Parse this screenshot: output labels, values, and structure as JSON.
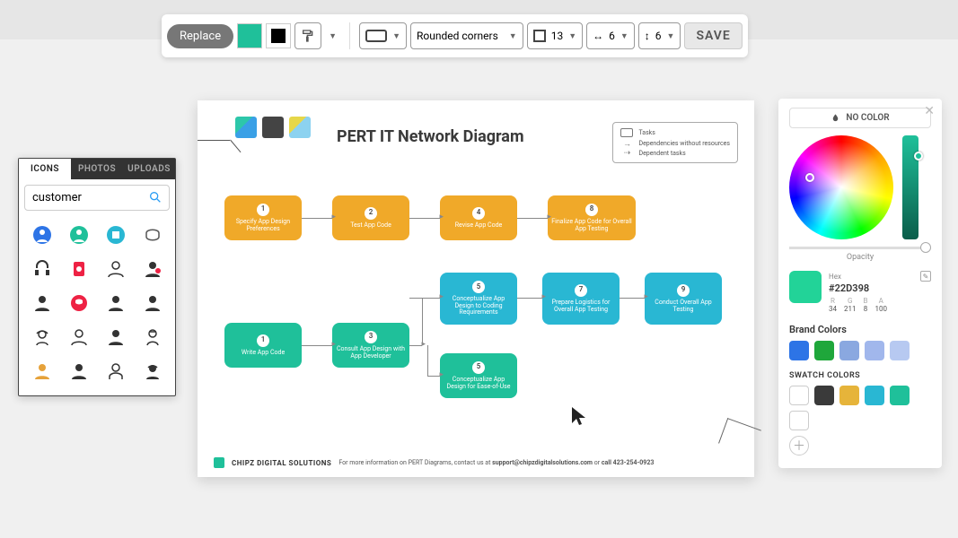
{
  "toolbar": {
    "replace_label": "Replace",
    "fill_color": "#1fc09a",
    "border_color": "#000",
    "shape_menu": "Rounded corners",
    "border_width": "13",
    "arrow_h": "6",
    "arrow_v": "6",
    "save_label": "SAVE"
  },
  "icon_panel": {
    "tabs": [
      "ICONS",
      "PHOTOS",
      "UPLOADS"
    ],
    "active_tab": 0,
    "search_value": "customer",
    "search_placeholder": "Search"
  },
  "canvas": {
    "title": "PERT IT Network Diagram",
    "legend": [
      "Tasks",
      "Dependencies without resources",
      "Dependent tasks"
    ],
    "nodes": {
      "o1": {
        "n": "1",
        "label": "Specify App Design Preferences"
      },
      "o2": {
        "n": "2",
        "label": "Test App Code"
      },
      "o4": {
        "n": "4",
        "label": "Revise App Code"
      },
      "o8": {
        "n": "8",
        "label": "Finalize App Code for Overall App Testing"
      },
      "g1": {
        "n": "1",
        "label": "Write App Code"
      },
      "g3": {
        "n": "3",
        "label": "Consult App Design with App Developer"
      },
      "c5a": {
        "n": "5",
        "label": "Conceptualize App Design to Coding Requirements"
      },
      "c7": {
        "n": "7",
        "label": "Prepare Logistics for Overall App Testing"
      },
      "c9": {
        "n": "9",
        "label": "Conduct Overall App Testing"
      },
      "g5b": {
        "n": "5",
        "label": "Conceptualize App Design for Ease-of-Use"
      }
    },
    "footer": {
      "brand": "CHIPZ DIGITAL SOLUTIONS",
      "text_prefix": "For more information on PERT Diagrams, contact us at ",
      "email": "support@chipzdigitalsolutions.com",
      "text_mid": " or ",
      "phone": "call 423-254-0923"
    }
  },
  "color_panel": {
    "no_color_label": "NO COLOR",
    "opacity_label": "Opacity",
    "hex_label": "Hex",
    "hex_value": "#22D398",
    "swatch_color": "#22D398",
    "rgb": {
      "r": "34",
      "g": "211",
      "b": "8",
      "a": "100"
    },
    "brand_label": "Brand Colors",
    "brand_colors": [
      "#2d74e6",
      "#1fa73b",
      "#8aa8e0",
      "#a1b7ec",
      "#b7c9f1"
    ],
    "swatch_label": "SWATCH COLORS",
    "swatch_colors": [
      "#ffffff",
      "#3a3a3a",
      "#e6b43a",
      "#29b7d3",
      "#1fc09a",
      "#ffffff"
    ]
  }
}
